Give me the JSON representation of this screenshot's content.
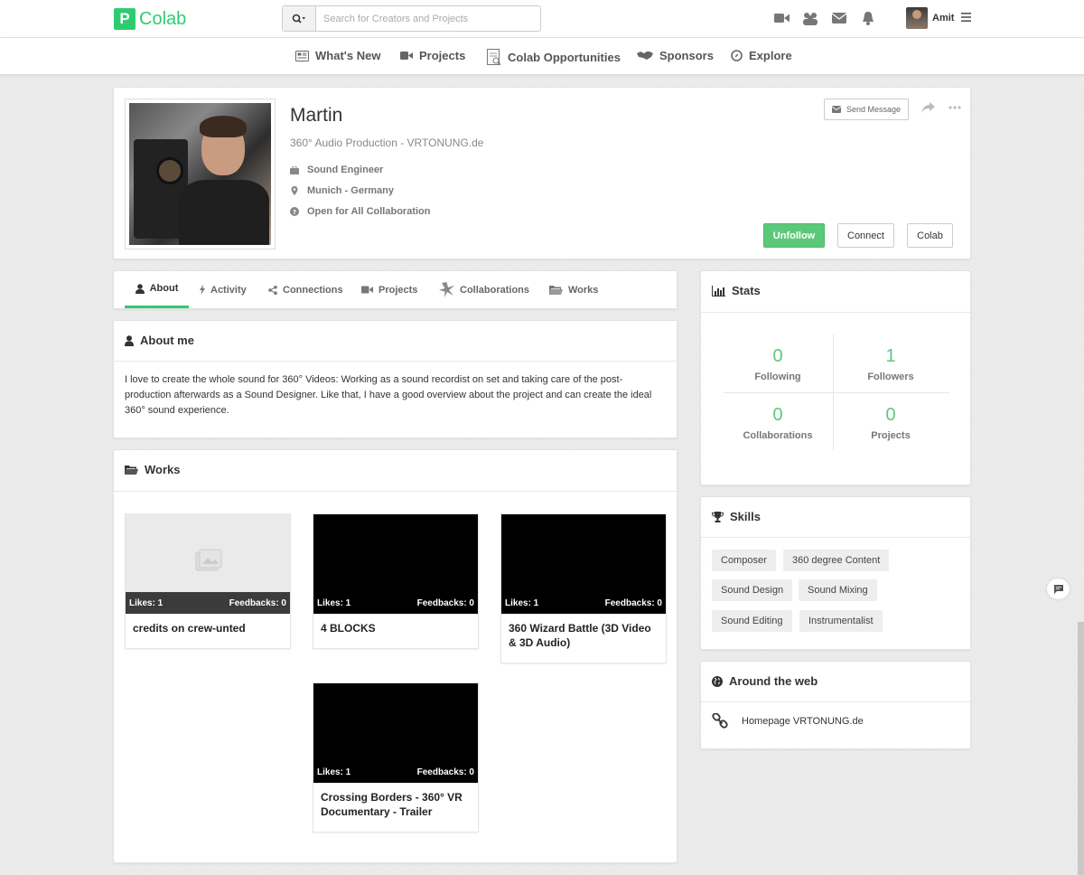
{
  "brand": {
    "logo_letter": "P",
    "name": "Colab",
    "color": "#2ecc71"
  },
  "search": {
    "placeholder": "Search for Creators and Projects"
  },
  "user": {
    "name": "Amit"
  },
  "top_icons": [
    "video-icon",
    "group-icon",
    "mail-icon",
    "bell-icon"
  ],
  "nav": {
    "items": [
      {
        "label": "What's New",
        "icon": "newspaper-icon"
      },
      {
        "label": "Projects",
        "icon": "video-icon"
      },
      {
        "label": "Colab Opportunities",
        "icon": "document-icon"
      },
      {
        "label": "Sponsors",
        "icon": "handshake-icon"
      },
      {
        "label": "Explore",
        "icon": "compass-icon"
      }
    ]
  },
  "profile": {
    "name": "Martin",
    "subtitle": "360° Audio Production - VRTONUNG.de",
    "role": "Sound Engineer",
    "location": "Munich - Germany",
    "availability": "Open for All Collaboration",
    "send_message": "Send Message",
    "buttons": {
      "unfollow": "Unfollow",
      "connect": "Connect",
      "colab": "Colab"
    }
  },
  "tabs": [
    {
      "label": "About",
      "icon": "user-icon",
      "active": true
    },
    {
      "label": "Activity",
      "icon": "bolt-icon",
      "active": false
    },
    {
      "label": "Connections",
      "icon": "share-icon",
      "active": false
    },
    {
      "label": "Projects",
      "icon": "video-icon",
      "active": false
    },
    {
      "label": "Collaborations",
      "icon": "burst-icon",
      "active": false
    },
    {
      "label": "Works",
      "icon": "folder-icon",
      "active": false
    }
  ],
  "about": {
    "title": "About me",
    "text": "I love to create the whole sound for 360° Videos: Working as a sound recordist on set and taking care of the post-production afterwards as a Sound Designer. Like that, I have a good overview about the project and can create the ideal 360° sound experience."
  },
  "works": {
    "title": "Works",
    "items": [
      {
        "title": "credits on crew-unted",
        "likes": "Likes: 1",
        "feedbacks": "Feedbacks: 0",
        "placeholder": true
      },
      {
        "title": "4 BLOCKS",
        "likes": "Likes: 1",
        "feedbacks": "Feedbacks: 0",
        "placeholder": false
      },
      {
        "title": "360 Wizard Battle (3D Video & 3D Audio)",
        "likes": "Likes: 1",
        "feedbacks": "Feedbacks: 0",
        "placeholder": false
      },
      {
        "title": "Crossing Borders - 360° VR Documentary - Trailer",
        "likes": "Likes: 1",
        "feedbacks": "Feedbacks: 0",
        "placeholder": false
      }
    ]
  },
  "stats": {
    "title": "Stats",
    "following": {
      "value": "0",
      "label": "Following"
    },
    "followers": {
      "value": "1",
      "label": "Followers"
    },
    "collaborations": {
      "value": "0",
      "label": "Collaborations"
    },
    "projects": {
      "value": "0",
      "label": "Projects"
    }
  },
  "skills": {
    "title": "Skills",
    "items": [
      "Composer",
      "360 degree Content",
      "Sound Design",
      "Sound Mixing",
      "Sound Editing",
      "Instrumentalist"
    ]
  },
  "web": {
    "title": "Around the web",
    "link": "Homepage VRTONUNG.de"
  }
}
